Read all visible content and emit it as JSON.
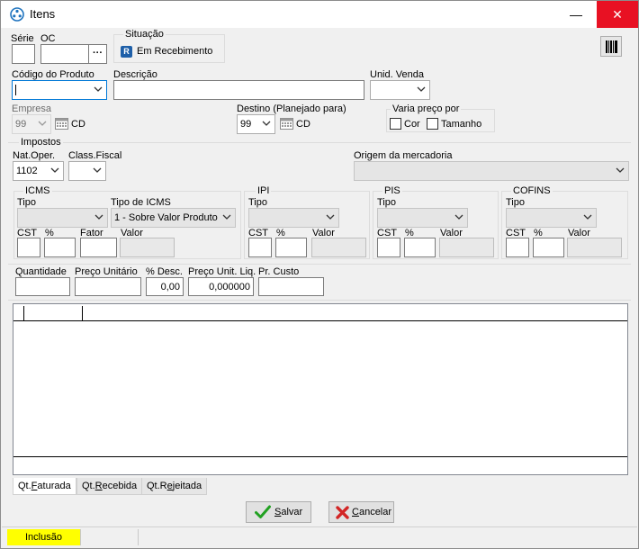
{
  "window": {
    "title": "Itens",
    "minimize_glyph": "—",
    "close_glyph": "✕"
  },
  "header": {
    "serie_label": "Série",
    "serie_value": "",
    "oc_label": "OC",
    "oc_value": "",
    "oc_lookup_label": "···",
    "situacao_title": "Situação",
    "situacao_badge": "R",
    "situacao_value": "Em Recebimento",
    "barcode_icon": "barcode-icon"
  },
  "produto": {
    "codigo_label": "Código do Produto",
    "codigo_value": "",
    "descricao_label": "Descrição",
    "descricao_value": "",
    "unid_label": "Unid. Venda",
    "unid_value": ""
  },
  "empresa": {
    "label": "Empresa",
    "value": "99",
    "suffix": "CD",
    "destino_label": "Destino (Planejado para)",
    "destino_value": "99",
    "destino_suffix": "CD",
    "varia_title": "Varia preço por",
    "cor_label": "Cor",
    "tamanho_label": "Tamanho"
  },
  "impostos": {
    "title": "Impostos",
    "natoper_label": "Nat.Oper.",
    "natoper_value": "1102",
    "classfiscal_label": "Class.Fiscal",
    "classfiscal_value": "",
    "origem_label": "Origem da mercadoria",
    "origem_value": "",
    "icms": {
      "title": "ICMS",
      "tipo_label": "Tipo",
      "tipo_value": "",
      "tipo_icms_label": "Tipo de ICMS",
      "tipo_icms_value": "1 - Sobre Valor Produto",
      "cst_label": "CST",
      "pct_label": "%",
      "fator_label": "Fator",
      "valor_label": "Valor"
    },
    "ipi": {
      "title": "IPI",
      "tipo_label": "Tipo",
      "cst_label": "CST",
      "pct_label": "%",
      "valor_label": "Valor"
    },
    "pis": {
      "title": "PIS",
      "tipo_label": "Tipo",
      "cst_label": "CST",
      "pct_label": "%",
      "valor_label": "Valor"
    },
    "cofins": {
      "title": "COFINS",
      "tipo_label": "Tipo",
      "cst_label": "CST",
      "pct_label": "%",
      "valor_label": "Valor"
    }
  },
  "valores": {
    "quantidade_label": "Quantidade",
    "quantidade_value": "",
    "preco_unit_label": "Preço Unitário",
    "preco_unit_value": "",
    "desc_label": "% Desc.",
    "desc_value": "0,00",
    "preco_liq_label": "Preço Unit. Liq.",
    "preco_liq_value": "0,000000",
    "pr_custo_label": "Pr. Custo",
    "pr_custo_value": ""
  },
  "tabs": [
    {
      "pre": "Qt.",
      "u": "F",
      "post": "aturada"
    },
    {
      "pre": "Qt.",
      "u": "R",
      "post": "ecebida"
    },
    {
      "pre": "Qt.R",
      "u": "e",
      "post": "jeitada"
    }
  ],
  "buttons": {
    "salvar_u": "S",
    "salvar_rest": "alvar",
    "cancelar_u": "C",
    "cancelar_rest": "ancelar"
  },
  "status": {
    "mode": "Inclusão",
    "mode_color": "#ffff00"
  }
}
